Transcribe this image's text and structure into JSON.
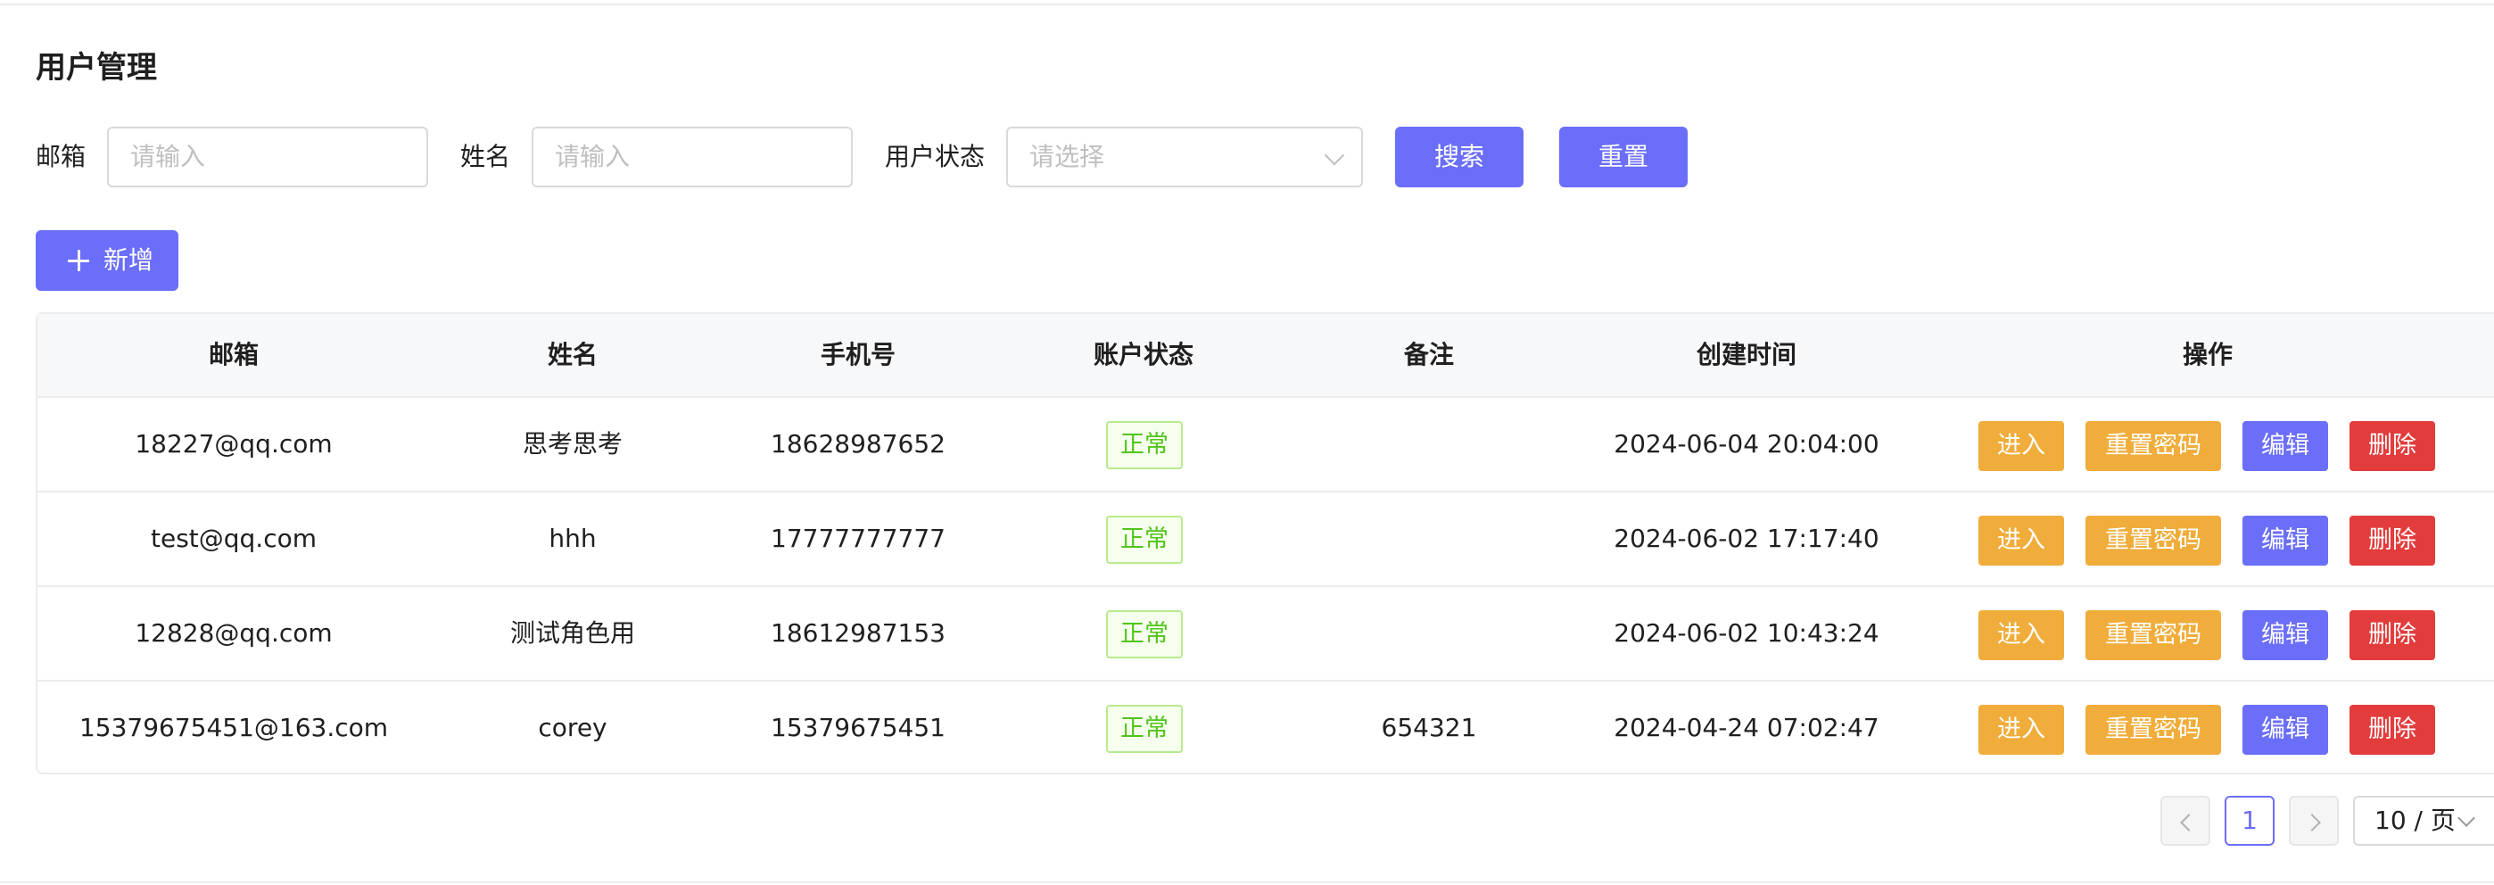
{
  "page": {
    "title": "用户管理"
  },
  "filters": {
    "email_label": "邮箱",
    "email_placeholder": "请输入",
    "name_label": "姓名",
    "name_placeholder": "请输入",
    "status_label": "用户状态",
    "status_placeholder": "请选择",
    "search_label": "搜索",
    "reset_label": "重置"
  },
  "toolbar": {
    "add_label": "新增"
  },
  "table": {
    "columns": [
      "邮箱",
      "姓名",
      "手机号",
      "账户状态",
      "备注",
      "创建时间",
      "操作"
    ],
    "rows": [
      {
        "email": "18227@qq.com",
        "name": "思考思考",
        "phone": "18628987652",
        "status": "正常",
        "remark": "",
        "created": "2024-06-04 20:04:00"
      },
      {
        "email": "test@qq.com",
        "name": "hhh",
        "phone": "17777777777",
        "status": "正常",
        "remark": "",
        "created": "2024-06-02 17:17:40"
      },
      {
        "email": "12828@qq.com",
        "name": "测试角色用",
        "phone": "18612987153",
        "status": "正常",
        "remark": "",
        "created": "2024-06-02 10:43:24"
      },
      {
        "email": "15379675451@163.com",
        "name": "corey",
        "phone": "15379675451",
        "status": "正常",
        "remark": "654321",
        "created": "2024-04-24 07:02:47"
      }
    ],
    "actions": {
      "enter": "进入",
      "reset_password": "重置密码",
      "edit": "编辑",
      "delete": "删除"
    }
  },
  "pagination": {
    "current_page": "1",
    "page_size": "10 / 页"
  },
  "colors": {
    "primary": "#6b6ef8",
    "warning": "#f0ad3c",
    "danger": "#e23c3c",
    "success": "#52c41a"
  },
  "icons": {
    "add": "plus-icon",
    "select": "chevron-down-icon",
    "prev": "chevron-left-icon",
    "next": "chevron-right-icon"
  }
}
